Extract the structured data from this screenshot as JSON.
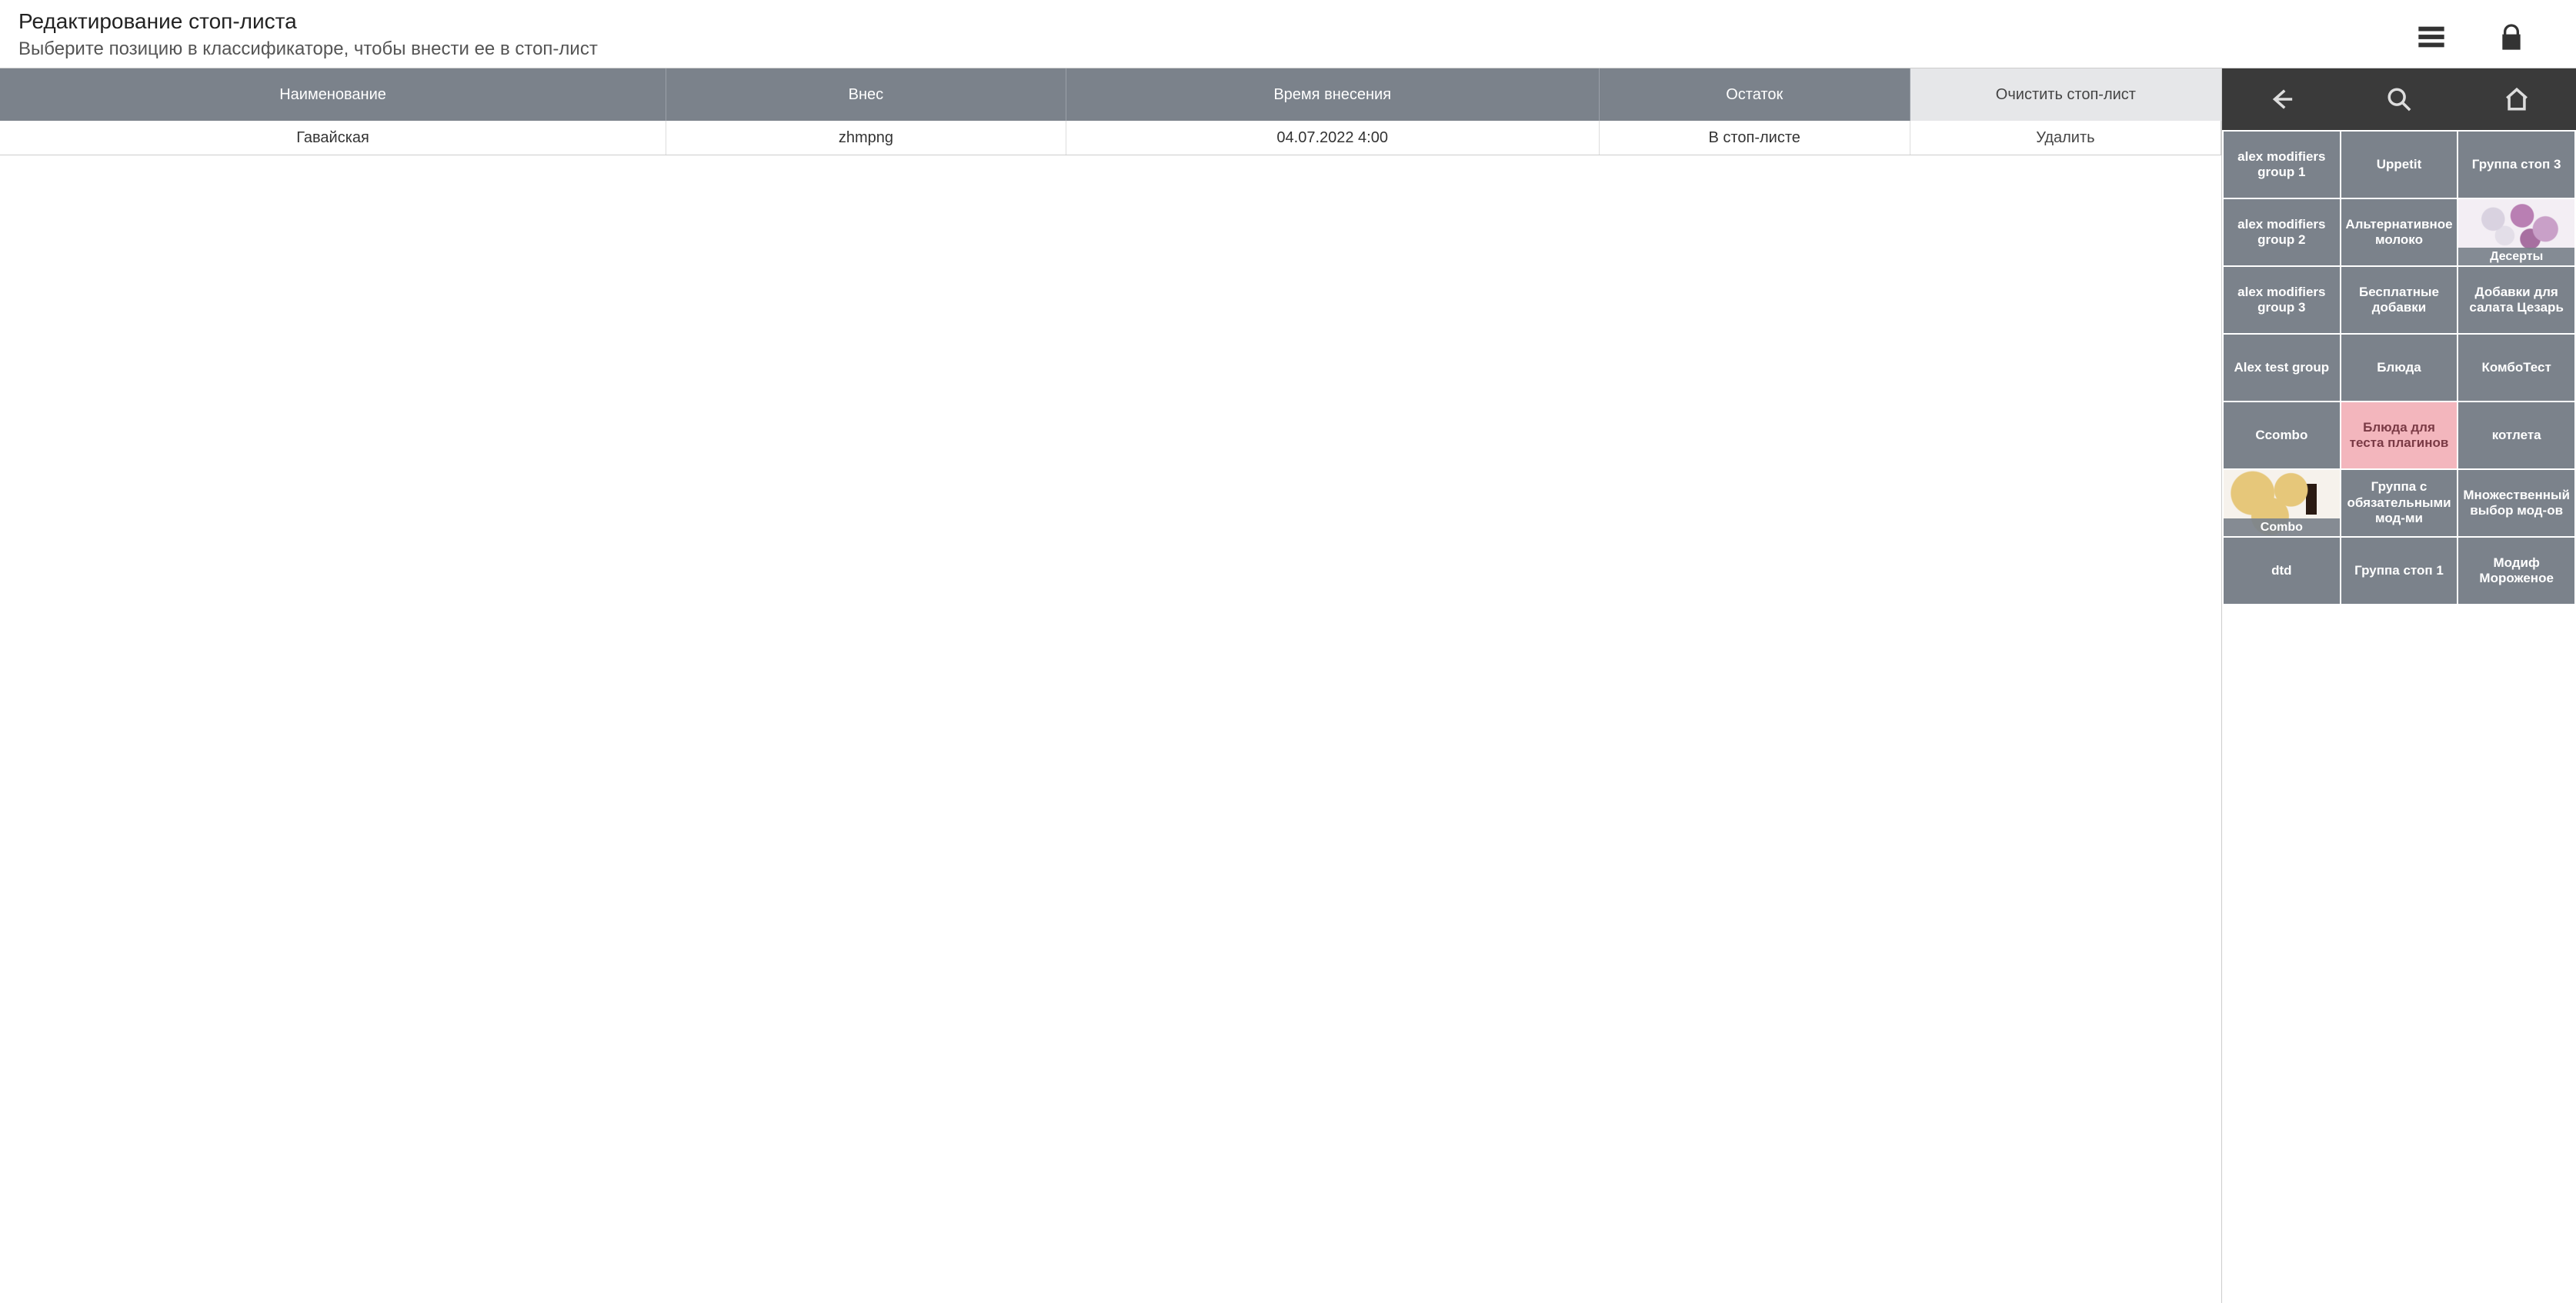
{
  "header": {
    "title": "Редактирование стоп-листа",
    "subtitle": "Выберите позицию в классификаторе, чтобы внести ее в стоп-лист"
  },
  "table": {
    "headers": {
      "name": "Наименование",
      "user": "Внес",
      "time": "Время внесения",
      "rest": "Остаток",
      "action": "Очистить стоп-лист"
    },
    "rows": [
      {
        "name": "Гавайская",
        "user": "zhmpng",
        "time": "04.07.2022 4:00",
        "rest": "В стоп-листе",
        "action": "Удалить"
      }
    ]
  },
  "grid": [
    {
      "label": "alex modifiers group 1"
    },
    {
      "label": "Uppetit"
    },
    {
      "label": "Группа стоп 3"
    },
    {
      "label": "alex modifiers group 2"
    },
    {
      "label": "Альтернативное молоко"
    },
    {
      "label": "Десерты",
      "image": "dessert"
    },
    {
      "label": "alex modifiers group 3"
    },
    {
      "label": "Бесплатные добавки"
    },
    {
      "label": "Добавки для салата Цезарь"
    },
    {
      "label": "Alex test group"
    },
    {
      "label": "Блюда"
    },
    {
      "label": "КомбоТест"
    },
    {
      "label": "Ccombo"
    },
    {
      "label": "Блюда для теста плагинов",
      "variant": "pink"
    },
    {
      "label": "котлета"
    },
    {
      "label": "Combo",
      "image": "pizza"
    },
    {
      "label": "Группа с обязательными мод-ми"
    },
    {
      "label": "Множественный выбор мод-ов"
    },
    {
      "label": "dtd"
    },
    {
      "label": "Группа стоп 1"
    },
    {
      "label": "Модиф Мороженое"
    }
  ]
}
